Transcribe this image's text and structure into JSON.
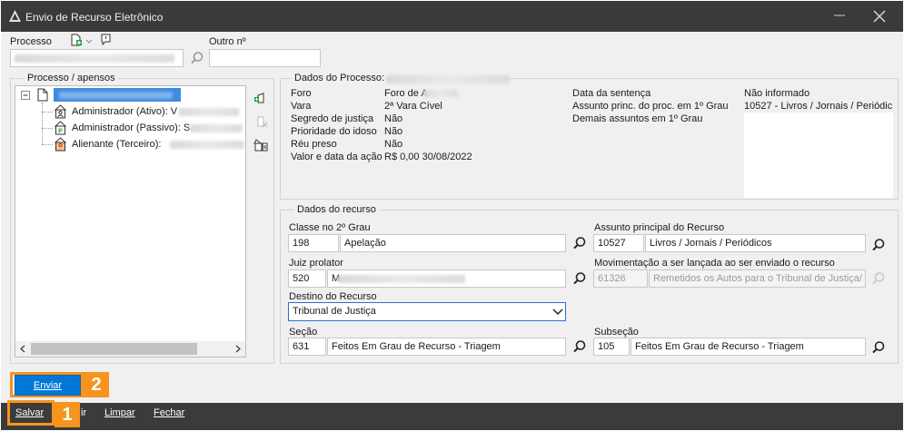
{
  "window": {
    "title": "Envio de Recurso Eletrônico"
  },
  "top": {
    "processo_label": "Processo",
    "outro_label": "Outro nº",
    "outro_value": ""
  },
  "tree": {
    "legend": "Processo / apensos",
    "items": [
      {
        "label": "Administrador (Ativo): V"
      },
      {
        "label": "Administrador (Passivo): S"
      },
      {
        "label": "Alienante (Terceiro):"
      }
    ]
  },
  "dados_processo": {
    "legend": "Dados do Processo:",
    "rows": [
      {
        "label": "Foro",
        "value": "Foro de A"
      },
      {
        "label": "Vara",
        "value": "2ª Vara Cível"
      },
      {
        "label": "Segredo de justiça",
        "value": "Não"
      },
      {
        "label": "Prioridade do idoso",
        "value": "Não"
      },
      {
        "label": "Réu preso",
        "value": "Não"
      },
      {
        "label": "Valor e data da ação",
        "value": "R$ 0,00 30/08/2022"
      }
    ],
    "right_labels": [
      "Data da sentença",
      "Assunto princ. do proc. em 1º Grau",
      "Demais assuntos em 1º Grau"
    ],
    "right_values": [
      "Não informado",
      "10527 - Livros / Jornais / Periódic"
    ]
  },
  "dados_recurso": {
    "legend": "Dados do recurso",
    "classe": {
      "label": "Classe no 2º Grau",
      "code": "198",
      "value": "Apelação"
    },
    "assunto": {
      "label": "Assunto principal do Recurso",
      "code": "10527",
      "value": "Livros / Jornais / Periódicos"
    },
    "juiz": {
      "label": "Juiz prolator",
      "code": "520",
      "value": "M"
    },
    "movimentacao": {
      "label": "Movimentação a ser lançada ao ser enviado o recurso",
      "code": "61326",
      "value": "Remetidos os Autos para o Tribunal de Justiça/"
    },
    "destino": {
      "label": "Destino do Recurso",
      "value": "Tribunal de Justiça"
    },
    "secao": {
      "label": "Seção",
      "code": "631",
      "value": "Feitos Em Grau de Recurso - Triagem"
    },
    "subsecao": {
      "label": "Subseção",
      "code": "105",
      "value": "Feitos Em Grau de Recurso - Triagem"
    }
  },
  "buttons": {
    "enviar": "Enviar"
  },
  "menu": {
    "salvar": "Salvar",
    "excluir_partial": "ir",
    "limpar": "Limpar",
    "fechar": "Fechar"
  },
  "callouts": {
    "one": "1",
    "two": "2"
  },
  "colors": {
    "accent": "#0078d7",
    "callout": "#f7941d",
    "titlebar": "#3a3a3a",
    "bottombar": "#3b3b3b"
  }
}
